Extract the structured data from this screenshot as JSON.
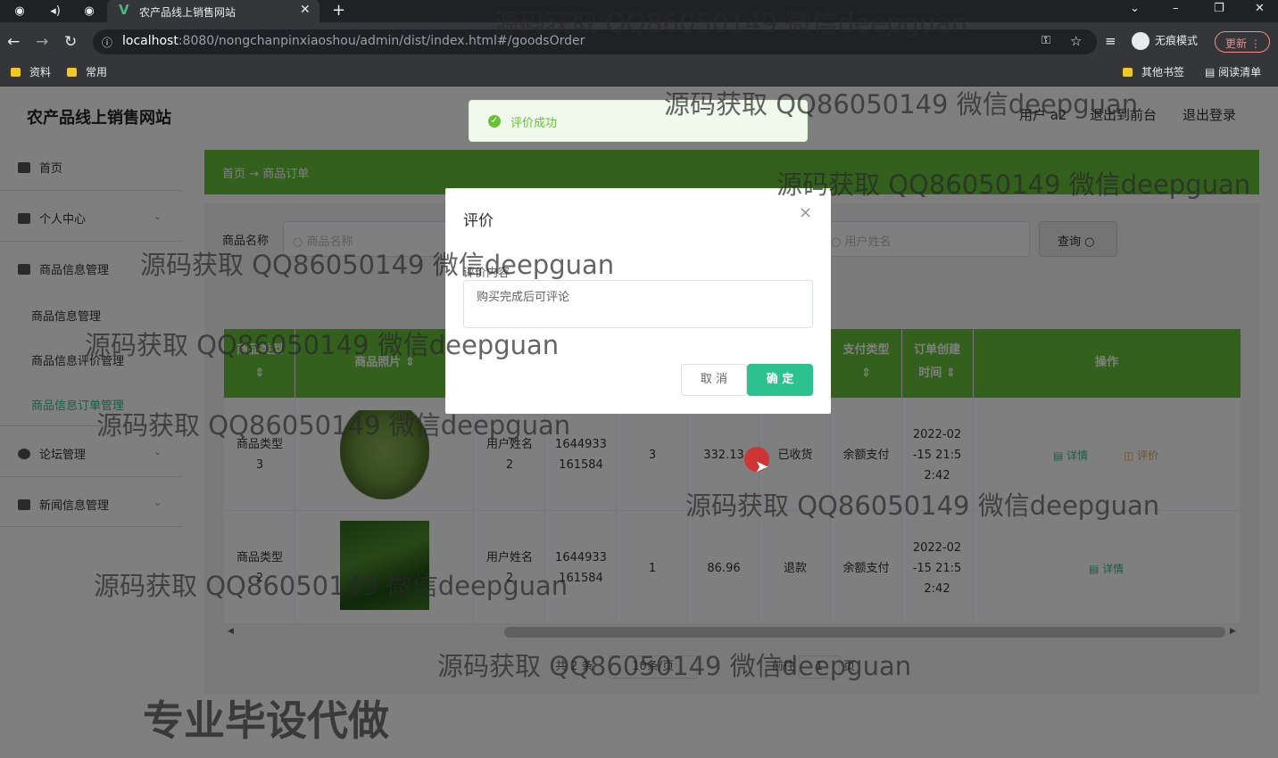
{
  "browser": {
    "tab_title": "农产品线上销售网站",
    "url_host": "localhost",
    "url_path": ":8080/nongchanpinxiaoshou/admin/dist/index.html#/goodsOrder",
    "incognito_label": "无痕模式",
    "update_label": "更新",
    "bookmarks": [
      "资料",
      "常用"
    ],
    "other_bookmarks": "其他书签",
    "reading_list": "阅读清单"
  },
  "app": {
    "site_title": "农产品线上销售网站",
    "header_links": [
      "用户 a2",
      "退出到前台",
      "退出登录"
    ]
  },
  "sidebar": {
    "items": [
      {
        "label": "首页"
      },
      {
        "label": "个人中心"
      },
      {
        "label": "商品信息管理"
      },
      {
        "label": "论坛管理"
      },
      {
        "label": "新闻信息管理"
      }
    ],
    "subitems": [
      "商品信息管理",
      "商品信息评价管理",
      "商品信息订单管理"
    ]
  },
  "breadcrumb": {
    "home": "首页",
    "arrow": "→",
    "current": "商品订单"
  },
  "search": {
    "goods_label": "商品名称",
    "goods_placeholder": "商品名称",
    "user_placeholder": "用户姓名",
    "button": "查询"
  },
  "table": {
    "headers": {
      "goods_type": "商品类型",
      "goods_photo": "商品照片",
      "pay_type": "支付类型",
      "create_time_1": "订单创建",
      "create_time_2": "时间",
      "ops": "操作"
    },
    "rows": [
      {
        "type_1": "商品类型",
        "type_2": "3",
        "user_1": "用户姓名",
        "user_2": "2",
        "order_1": "1644933",
        "order_2": "161584",
        "qty": "3",
        "price": "332.13",
        "status": "已收货",
        "pay": "余额支付",
        "time_1": "2022-02",
        "time_2": "-15 21:5",
        "time_3": "2:42",
        "detail": "详情",
        "review": "评价"
      },
      {
        "type_1": "商品类型",
        "type_2": "2",
        "user_1": "用户姓名",
        "user_2": "2",
        "order_1": "1644933",
        "order_2": "161584",
        "qty": "1",
        "price": "86.96",
        "status": "退款",
        "pay": "余额支付",
        "time_1": "2022-02",
        "time_2": "-15 21:5",
        "time_3": "2:42",
        "detail": "详情"
      }
    ]
  },
  "pager": {
    "total": "共 2 条",
    "per_page": "10条/页",
    "goto": "前往",
    "page": "1",
    "unit": "页"
  },
  "dialog": {
    "title": "评价",
    "close": "×",
    "field_label": "评价内容",
    "textarea_value": "购买完成后可评论",
    "cancel": "取 消",
    "ok": "确 定"
  },
  "toast": {
    "message": "评价成功"
  },
  "watermark": {
    "text": "源码获取 QQ86050149 微信deepguan",
    "footer": "专业毕设代做"
  },
  "colors": {
    "primary_green": "#67c23a",
    "confirm_button": "#2cc18f"
  }
}
